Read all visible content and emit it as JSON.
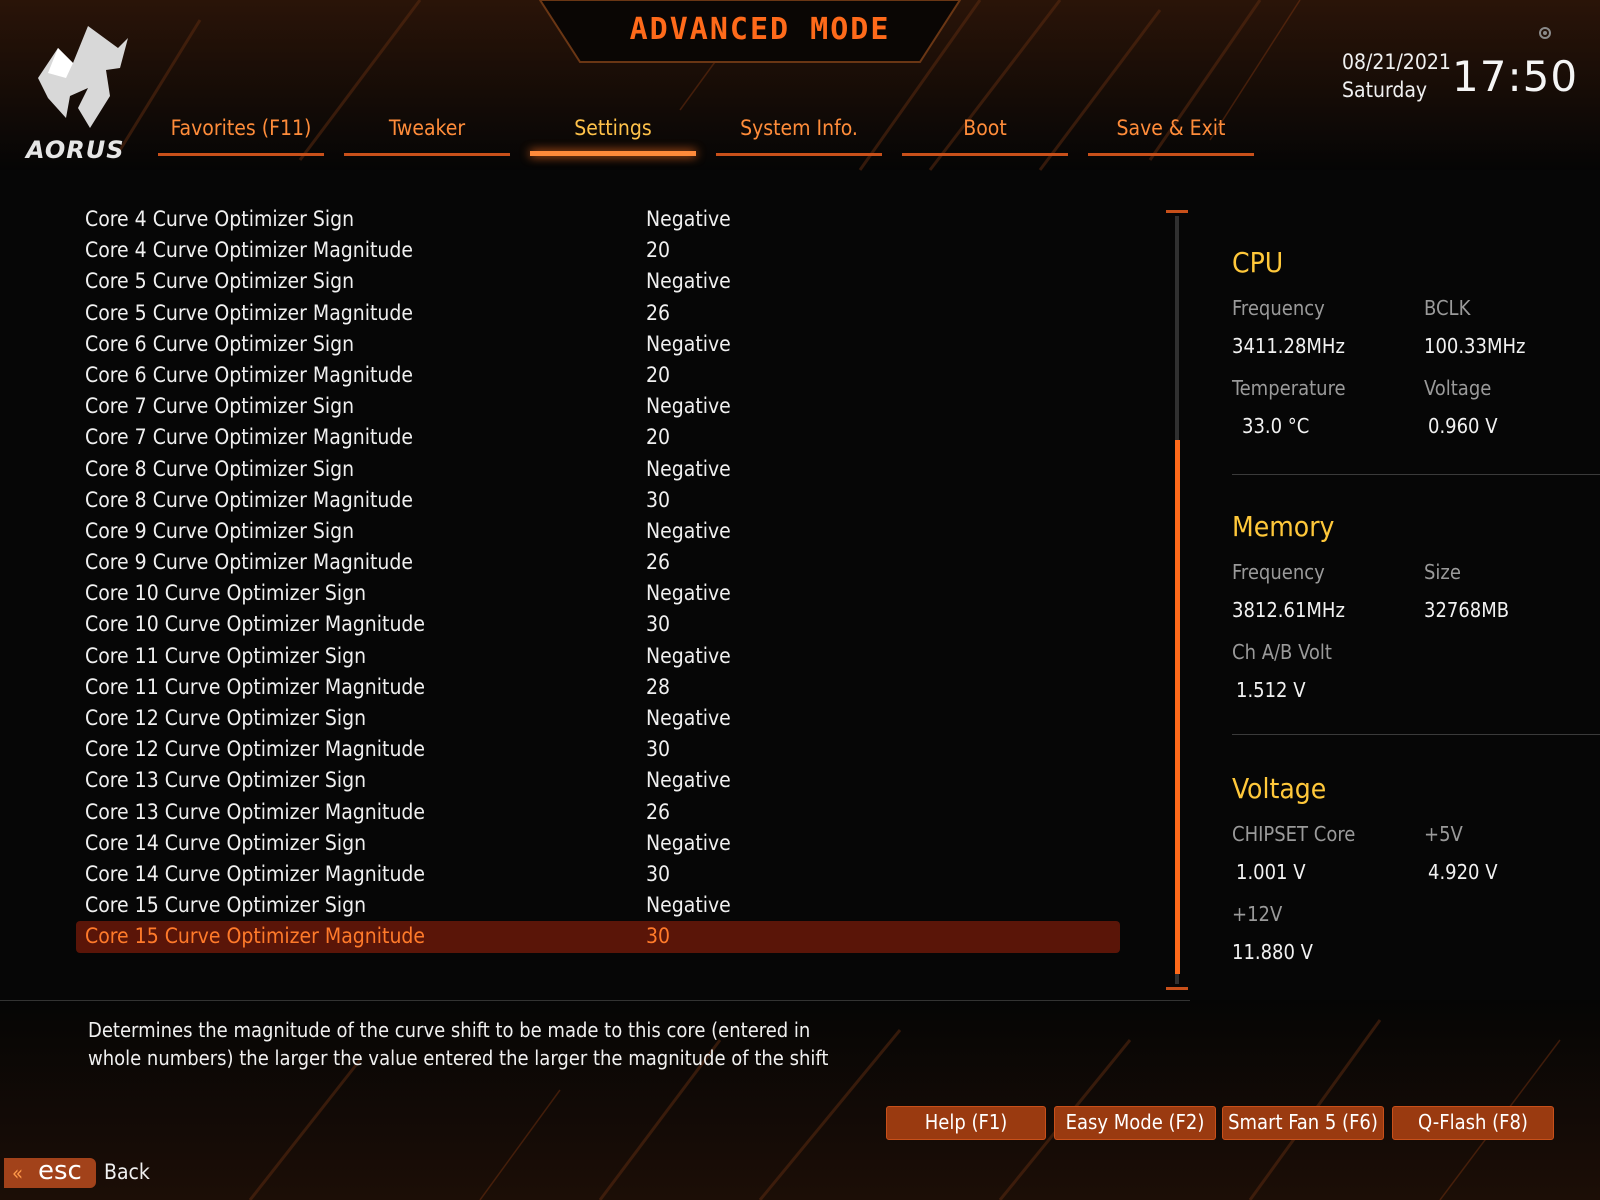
{
  "header": {
    "title": "ADVANCED MODE",
    "brand": "AORUS",
    "date": "08/21/2021",
    "weekday": "Saturday",
    "time": "17:50"
  },
  "tabs": [
    {
      "label": "Favorites (F11)",
      "active": false
    },
    {
      "label": "Tweaker",
      "active": false
    },
    {
      "label": "Settings",
      "active": true
    },
    {
      "label": "System Info.",
      "active": false
    },
    {
      "label": "Boot",
      "active": false
    },
    {
      "label": "Save & Exit",
      "active": false
    }
  ],
  "settings": [
    {
      "label": "Core 4 Curve Optimizer Sign",
      "value": "Negative"
    },
    {
      "label": "Core 4 Curve Optimizer Magnitude",
      "value": "20"
    },
    {
      "label": "Core 5 Curve Optimizer Sign",
      "value": "Negative"
    },
    {
      "label": "Core 5 Curve Optimizer Magnitude",
      "value": "26"
    },
    {
      "label": "Core 6 Curve Optimizer Sign",
      "value": "Negative"
    },
    {
      "label": "Core 6 Curve Optimizer Magnitude",
      "value": "20"
    },
    {
      "label": "Core 7 Curve Optimizer Sign",
      "value": "Negative"
    },
    {
      "label": "Core 7 Curve Optimizer Magnitude",
      "value": "20"
    },
    {
      "label": "Core 8 Curve Optimizer Sign",
      "value": "Negative"
    },
    {
      "label": "Core 8 Curve Optimizer Magnitude",
      "value": "30"
    },
    {
      "label": "Core 9 Curve Optimizer Sign",
      "value": "Negative"
    },
    {
      "label": "Core 9 Curve Optimizer Magnitude",
      "value": "26"
    },
    {
      "label": "Core 10 Curve Optimizer Sign",
      "value": "Negative"
    },
    {
      "label": "Core 10 Curve Optimizer Magnitude",
      "value": "30"
    },
    {
      "label": "Core 11 Curve Optimizer Sign",
      "value": "Negative"
    },
    {
      "label": "Core 11 Curve Optimizer Magnitude",
      "value": "28"
    },
    {
      "label": "Core 12 Curve Optimizer Sign",
      "value": "Negative"
    },
    {
      "label": "Core 12 Curve Optimizer Magnitude",
      "value": "30"
    },
    {
      "label": "Core 13 Curve Optimizer Sign",
      "value": "Negative"
    },
    {
      "label": "Core 13 Curve Optimizer Magnitude",
      "value": "26"
    },
    {
      "label": "Core 14 Curve Optimizer Sign",
      "value": "Negative"
    },
    {
      "label": "Core 14 Curve Optimizer Magnitude",
      "value": "30"
    },
    {
      "label": "Core 15 Curve Optimizer Sign",
      "value": "Negative"
    },
    {
      "label": "Core 15 Curve Optimizer Magnitude",
      "value": "30",
      "selected": true
    }
  ],
  "panel": {
    "cpu": {
      "title": "CPU",
      "freq_label": "Frequency",
      "freq_value": "3411.28MHz",
      "bclk_label": "BCLK",
      "bclk_value": "100.33MHz",
      "temp_label": "Temperature",
      "temp_value": "33.0 °C",
      "volt_label": "Voltage",
      "volt_value": "0.960 V"
    },
    "memory": {
      "title": "Memory",
      "freq_label": "Frequency",
      "freq_value": "3812.61MHz",
      "size_label": "Size",
      "size_value": "32768MB",
      "chvolt_label": "Ch A/B Volt",
      "chvolt_value": "1.512 V"
    },
    "voltage": {
      "title": "Voltage",
      "chipset_label": "CHIPSET Core",
      "chipset_value": "1.001 V",
      "p5v_label": "+5V",
      "p5v_value": "4.920 V",
      "p12v_label": "+12V",
      "p12v_value": "11.880 V"
    }
  },
  "help_text": "Determines the magnitude of the curve shift to be made to this core (entered in whole numbers) the larger the value entered the larger the magnitude of the shift",
  "buttons": {
    "help": "Help (F1)",
    "easy_mode": "Easy Mode (F2)",
    "smart_fan": "Smart Fan 5 (F6)",
    "qflash": "Q-Flash (F8)",
    "esc": "esc",
    "back": "Back"
  },
  "colors": {
    "accent": "#ff6a1a",
    "section_title": "#ffc83a",
    "selected_row_bg": "#5a1508",
    "tab_text": "#ff8c3a"
  }
}
